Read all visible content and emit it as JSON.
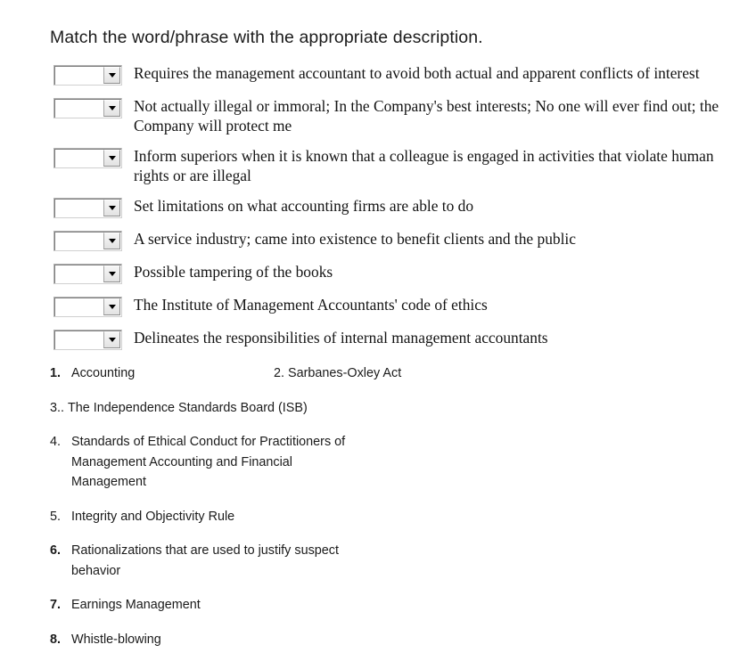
{
  "page": {
    "title": "Match the word/phrase with the appropriate description.",
    "background_color": "#ffffff",
    "text_color": "#1b1b1b"
  },
  "match_rows": [
    {
      "select": {
        "value": "",
        "placeholder": "",
        "icon": "chevron-down-icon"
      },
      "description": "Requires the management accountant to avoid both actual and apparent conflicts of interest"
    },
    {
      "select": {
        "value": "",
        "placeholder": "",
        "icon": "chevron-down-icon"
      },
      "description": "Not actually illegal or immoral; In the Company's best interests; No one will ever find out; the Company will protect me"
    },
    {
      "select": {
        "value": "",
        "placeholder": "",
        "icon": "chevron-down-icon"
      },
      "description": "Inform superiors when it is known that a colleague is engaged in activities that violate human rights or are illegal"
    },
    {
      "select": {
        "value": "",
        "placeholder": "",
        "icon": "chevron-down-icon"
      },
      "description": "Set limitations on what accounting firms are able to do"
    },
    {
      "select": {
        "value": "",
        "placeholder": "",
        "icon": "chevron-down-icon"
      },
      "description": "A service industry; came into existence to benefit clients and the public"
    },
    {
      "select": {
        "value": "",
        "placeholder": "",
        "icon": "chevron-down-icon"
      },
      "description": "Possible tampering of the books"
    },
    {
      "select": {
        "value": "",
        "placeholder": "",
        "icon": "chevron-down-icon"
      },
      "description": "The Institute of Management Accountants' code of ethics"
    },
    {
      "select": {
        "value": "",
        "placeholder": "",
        "icon": "chevron-down-icon"
      },
      "description": "Delineates the responsibilities of internal management accountants"
    }
  ],
  "answer_options": [
    {
      "number": "1.",
      "bold_number": true,
      "text": "Accounting"
    },
    {
      "number": "2.",
      "bold_number": false,
      "text": "Sarbanes-Oxley Act"
    },
    {
      "number": "3..",
      "bold_number": false,
      "text": "The Independence Standards Board (ISB)"
    },
    {
      "number": "4.",
      "bold_number": false,
      "text": "Standards of Ethical Conduct for Practitioners of Management Accounting and Financial Management"
    },
    {
      "number": "5.",
      "bold_number": false,
      "text": "Integrity and Objectivity Rule"
    },
    {
      "number": "6.",
      "bold_number": true,
      "text": "Rationalizations that are used to justify suspect behavior"
    },
    {
      "number": "7.",
      "bold_number": true,
      "text": "Earnings Management"
    },
    {
      "number": "8.",
      "bold_number": true,
      "text": "Whistle-blowing"
    }
  ]
}
